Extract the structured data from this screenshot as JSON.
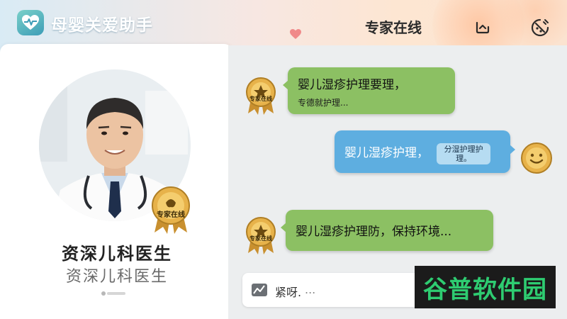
{
  "header": {
    "app_title": "母婴关爱助手",
    "status_text": "专家在线",
    "icons": [
      "heart-logo-icon",
      "refresh-icon",
      "clear-chat-icon"
    ]
  },
  "profile": {
    "badge_text": "专家在线",
    "title": "资深儿科医生",
    "subtitle": "资深儿科医生",
    "pager": {
      "count": 2,
      "active": 0
    }
  },
  "chat": {
    "messages": [
      {
        "sender": "expert",
        "badge": "专家在线",
        "text": "婴儿湿疹护理要理，",
        "sub": "专德就护理..."
      },
      {
        "sender": "user",
        "text": "婴儿湿疹护理，",
        "note": "分湿护理护理。"
      },
      {
        "sender": "expert",
        "badge": "专家在线",
        "text": "婴儿湿疹护理防，保持环境..."
      }
    ],
    "input": {
      "text": "紧呀.",
      "dots": "..."
    }
  },
  "watermark": {
    "text": "谷普软件园"
  },
  "colors": {
    "green_bubble": "#8cc063",
    "blue_bubble": "#5eaee0",
    "badge_gold": "#d9a441",
    "watermark_green": "#2ecc71"
  }
}
